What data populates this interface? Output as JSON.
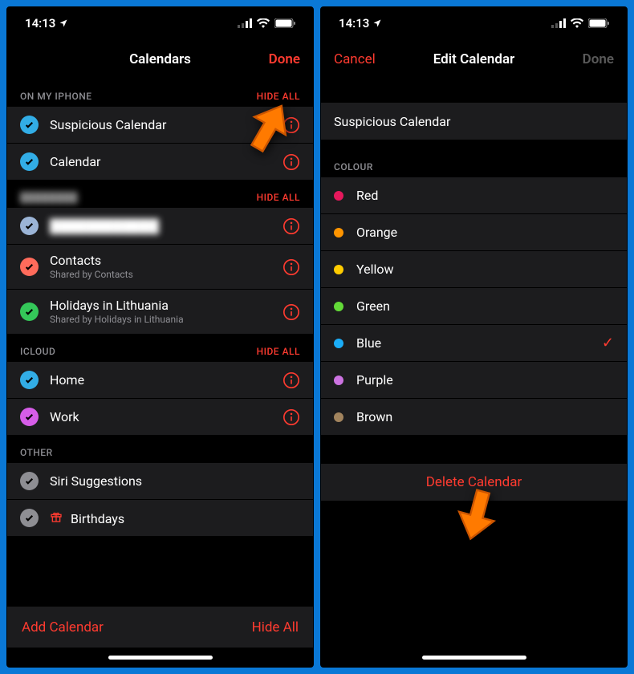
{
  "status": {
    "time": "14:13"
  },
  "left": {
    "nav": {
      "title": "Calendars",
      "right": "Done"
    },
    "sections": [
      {
        "title": "ON MY IPHONE",
        "hideall": "HIDE ALL",
        "items": [
          {
            "label": "Suspicious Calendar",
            "color": "#32ade6",
            "checked": true
          },
          {
            "label": "Calendar",
            "color": "#32ade6",
            "checked": true
          }
        ]
      },
      {
        "title": "████████",
        "hideall": "HIDE ALL",
        "items": [
          {
            "label": "████████████",
            "color": "#9bb4d6",
            "checked": true,
            "blur": true
          },
          {
            "label": "Contacts",
            "sublabel": "Shared by Contacts",
            "color": "#ff6b5b",
            "checked": true
          },
          {
            "label": "Holidays in Lithuania",
            "sublabel": "Shared by Holidays in Lithuania",
            "color": "#34c759",
            "checked": true
          }
        ]
      },
      {
        "title": "ICLOUD",
        "hideall": "HIDE ALL",
        "items": [
          {
            "label": "Home",
            "color": "#32ade6",
            "checked": true
          },
          {
            "label": "Work",
            "color": "#d65de8",
            "checked": true
          }
        ]
      },
      {
        "title": "OTHER",
        "items": [
          {
            "label": "Siri Suggestions",
            "color": "#8e8e93",
            "checked": true
          },
          {
            "label": "Birthdays",
            "color": "#8e8e93",
            "checked": true,
            "gift": true
          }
        ]
      }
    ],
    "footer": {
      "add": "Add Calendar",
      "hide": "Hide All"
    }
  },
  "right": {
    "nav": {
      "left": "Cancel",
      "title": "Edit Calendar",
      "right": "Done"
    },
    "name_value": "Suspicious Calendar",
    "colour_header": "COLOUR",
    "colours": [
      {
        "label": "Red",
        "hex": "#e6185c"
      },
      {
        "label": "Orange",
        "hex": "#ff9500"
      },
      {
        "label": "Yellow",
        "hex": "#ffcc00"
      },
      {
        "label": "Green",
        "hex": "#63da38"
      },
      {
        "label": "Blue",
        "hex": "#1badf8",
        "selected": true
      },
      {
        "label": "Purple",
        "hex": "#cc73e1"
      },
      {
        "label": "Brown",
        "hex": "#a2845e"
      }
    ],
    "delete": "Delete Calendar"
  }
}
